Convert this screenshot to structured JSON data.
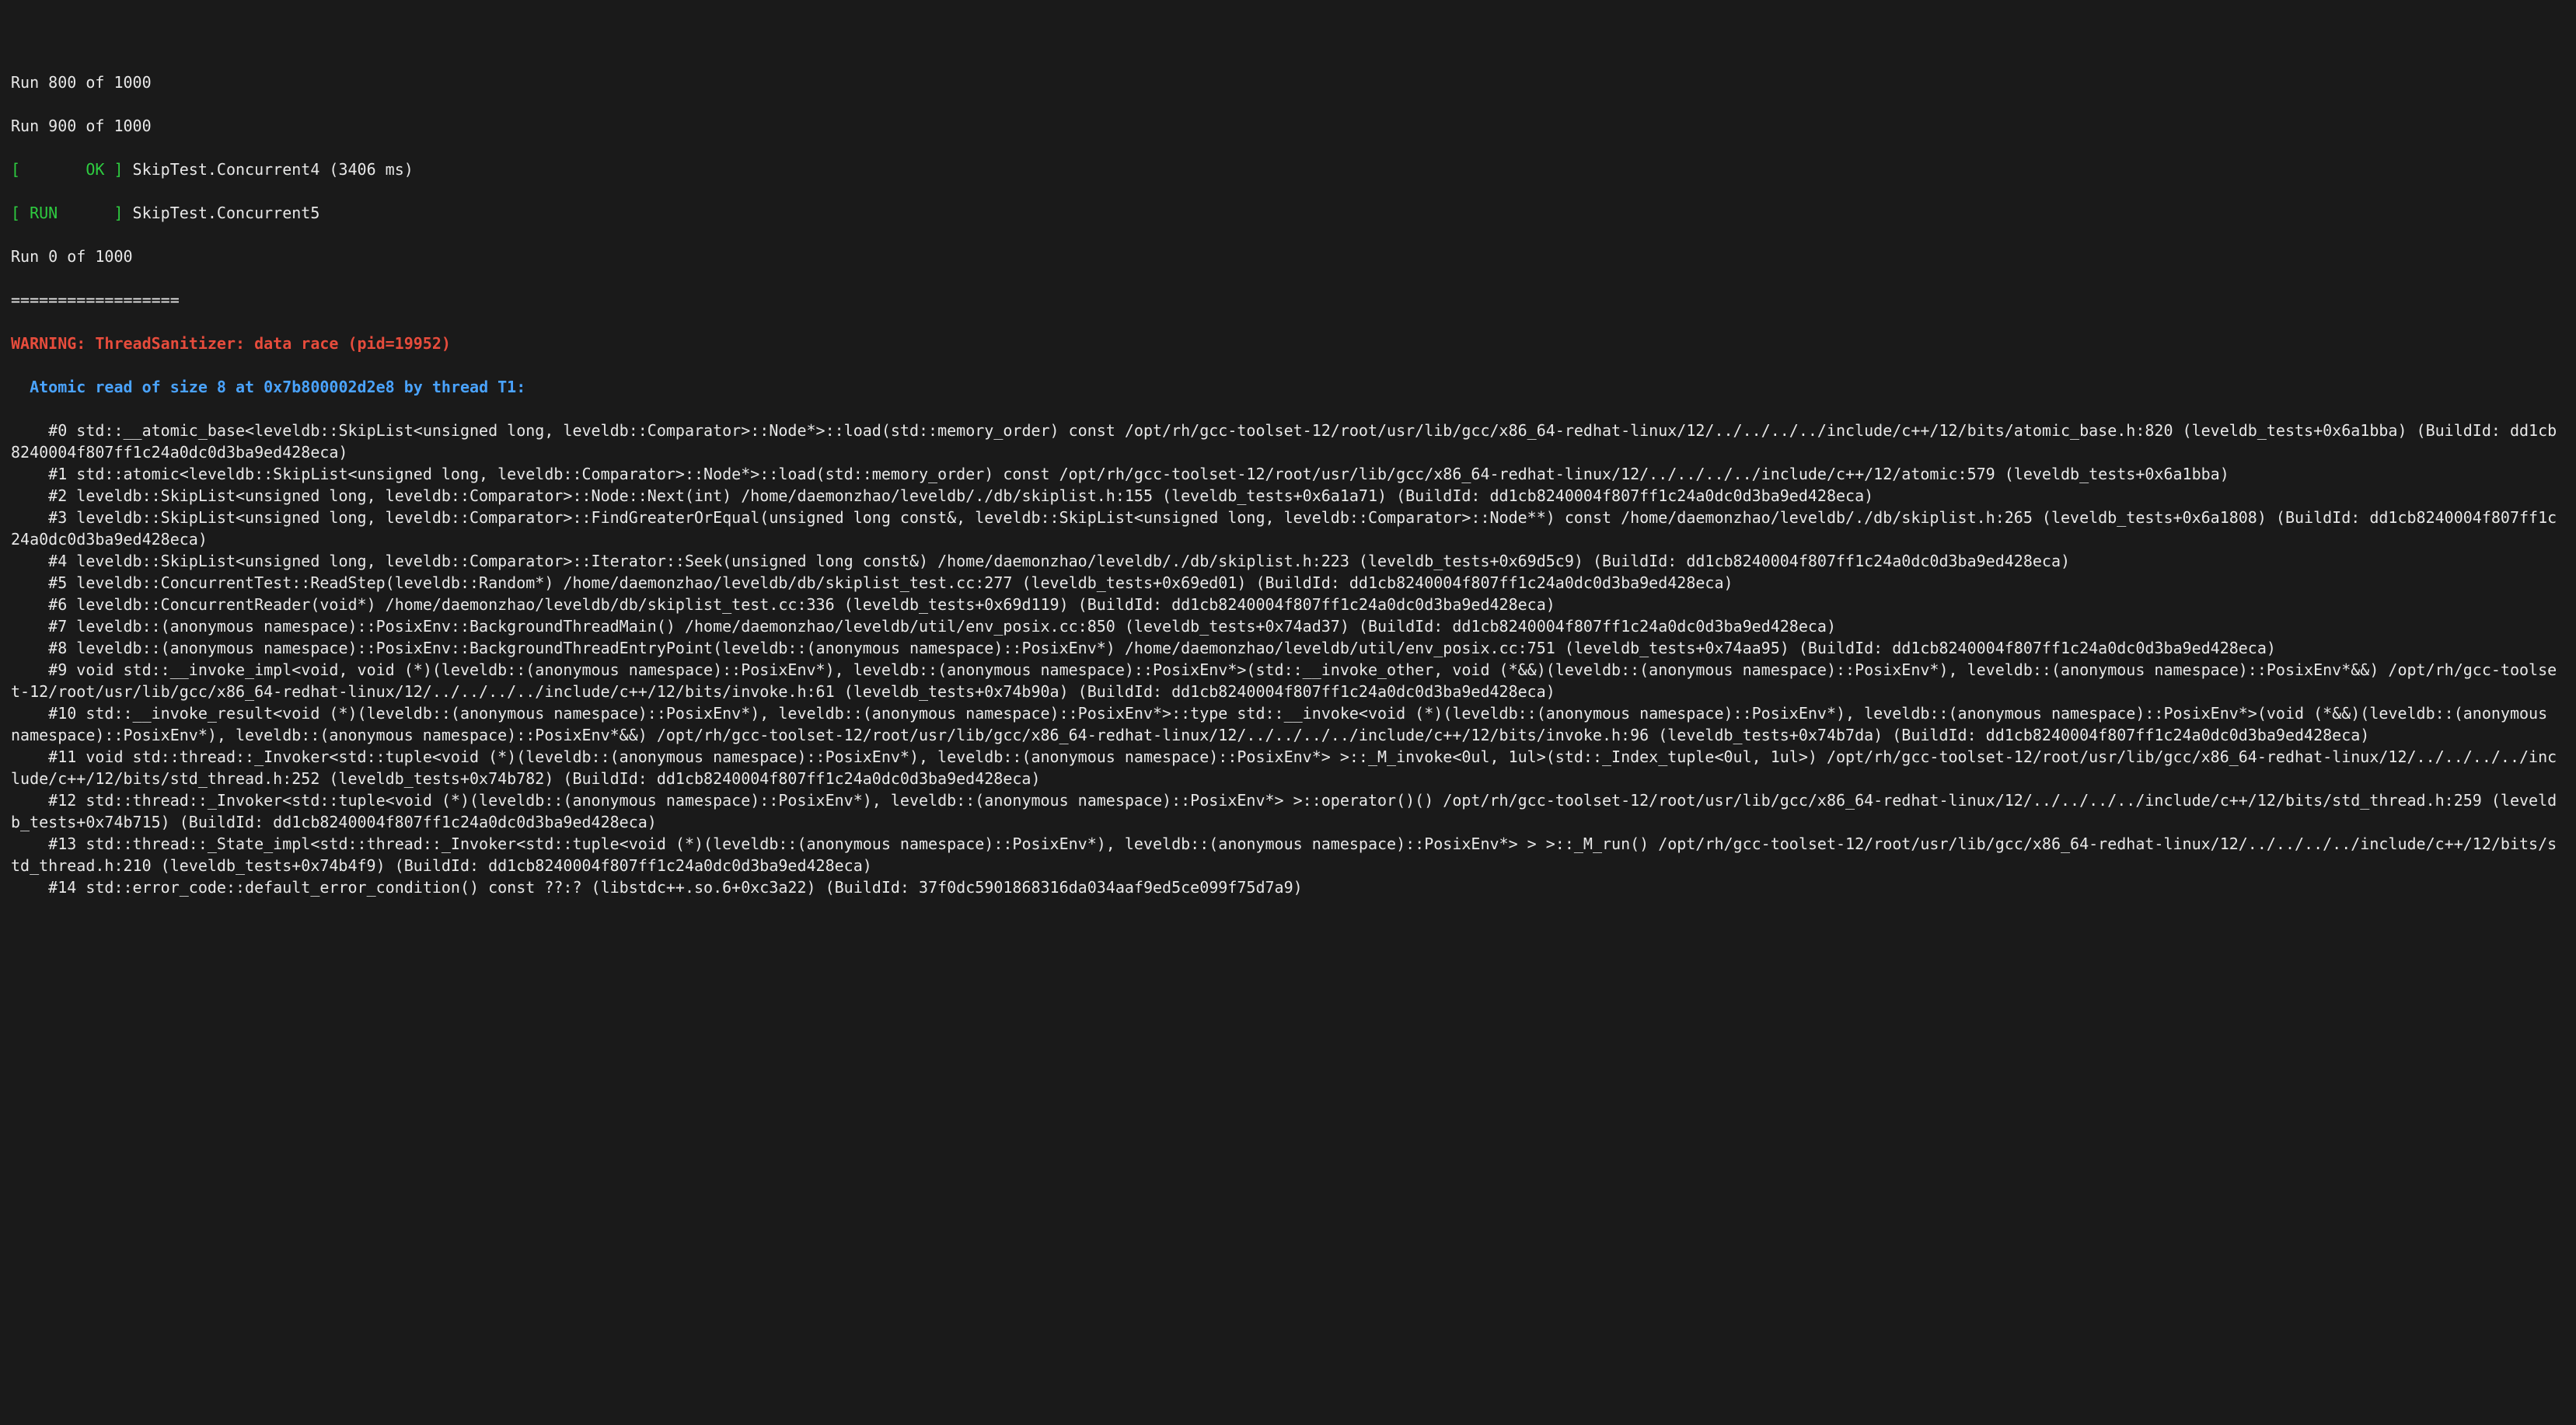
{
  "progress": {
    "run800": "Run 800 of 1000",
    "run900": "Run 900 of 1000",
    "ok_open": "[       OK ]",
    "ok_text": " SkipTest.Concurrent4 (3406 ms)",
    "run_open": "[ RUN      ]",
    "run_text": " SkipTest.Concurrent5",
    "run0": "Run 0 of 1000"
  },
  "divider": "==================",
  "warn": "WARNING: ThreadSanitizer: data race (pid=19952)",
  "read_hdr": "  Atomic read of size 8 at 0x7b800002d2e8 by thread T1:",
  "frames": [
    "    #0 std::__atomic_base<leveldb::SkipList<unsigned long, leveldb::Comparator>::Node*>::load(std::memory_order) const /opt/rh/gcc-toolset-12/root/usr/lib/gcc/x86_64-redhat-linux/12/../../../../include/c++/12/bits/atomic_base.h:820 (leveldb_tests+0x6a1bba) (BuildId: dd1cb8240004f807ff1c24a0dc0d3ba9ed428eca)",
    "    #1 std::atomic<leveldb::SkipList<unsigned long, leveldb::Comparator>::Node*>::load(std::memory_order) const /opt/rh/gcc-toolset-12/root/usr/lib/gcc/x86_64-redhat-linux/12/../../../../include/c++/12/atomic:579 (leveldb_tests+0x6a1bba)",
    "    #2 leveldb::SkipList<unsigned long, leveldb::Comparator>::Node::Next(int) /home/daemonzhao/leveldb/./db/skiplist.h:155 (leveldb_tests+0x6a1a71) (BuildId: dd1cb8240004f807ff1c24a0dc0d3ba9ed428eca)",
    "    #3 leveldb::SkipList<unsigned long, leveldb::Comparator>::FindGreaterOrEqual(unsigned long const&, leveldb::SkipList<unsigned long, leveldb::Comparator>::Node**) const /home/daemonzhao/leveldb/./db/skiplist.h:265 (leveldb_tests+0x6a1808) (BuildId: dd1cb8240004f807ff1c24a0dc0d3ba9ed428eca)",
    "    #4 leveldb::SkipList<unsigned long, leveldb::Comparator>::Iterator::Seek(unsigned long const&) /home/daemonzhao/leveldb/./db/skiplist.h:223 (leveldb_tests+0x69d5c9) (BuildId: dd1cb8240004f807ff1c24a0dc0d3ba9ed428eca)",
    "    #5 leveldb::ConcurrentTest::ReadStep(leveldb::Random*) /home/daemonzhao/leveldb/db/skiplist_test.cc:277 (leveldb_tests+0x69ed01) (BuildId: dd1cb8240004f807ff1c24a0dc0d3ba9ed428eca)",
    "    #6 leveldb::ConcurrentReader(void*) /home/daemonzhao/leveldb/db/skiplist_test.cc:336 (leveldb_tests+0x69d119) (BuildId: dd1cb8240004f807ff1c24a0dc0d3ba9ed428eca)",
    "    #7 leveldb::(anonymous namespace)::PosixEnv::BackgroundThreadMain() /home/daemonzhao/leveldb/util/env_posix.cc:850 (leveldb_tests+0x74ad37) (BuildId: dd1cb8240004f807ff1c24a0dc0d3ba9ed428eca)",
    "    #8 leveldb::(anonymous namespace)::PosixEnv::BackgroundThreadEntryPoint(leveldb::(anonymous namespace)::PosixEnv*) /home/daemonzhao/leveldb/util/env_posix.cc:751 (leveldb_tests+0x74aa95) (BuildId: dd1cb8240004f807ff1c24a0dc0d3ba9ed428eca)",
    "    #9 void std::__invoke_impl<void, void (*)(leveldb::(anonymous namespace)::PosixEnv*), leveldb::(anonymous namespace)::PosixEnv*>(std::__invoke_other, void (*&&)(leveldb::(anonymous namespace)::PosixEnv*), leveldb::(anonymous namespace)::PosixEnv*&&) /opt/rh/gcc-toolset-12/root/usr/lib/gcc/x86_64-redhat-linux/12/../../../../include/c++/12/bits/invoke.h:61 (leveldb_tests+0x74b90a) (BuildId: dd1cb8240004f807ff1c24a0dc0d3ba9ed428eca)",
    "    #10 std::__invoke_result<void (*)(leveldb::(anonymous namespace)::PosixEnv*), leveldb::(anonymous namespace)::PosixEnv*>::type std::__invoke<void (*)(leveldb::(anonymous namespace)::PosixEnv*), leveldb::(anonymous namespace)::PosixEnv*>(void (*&&)(leveldb::(anonymous namespace)::PosixEnv*), leveldb::(anonymous namespace)::PosixEnv*&&) /opt/rh/gcc-toolset-12/root/usr/lib/gcc/x86_64-redhat-linux/12/../../../../include/c++/12/bits/invoke.h:96 (leveldb_tests+0x74b7da) (BuildId: dd1cb8240004f807ff1c24a0dc0d3ba9ed428eca)",
    "    #11 void std::thread::_Invoker<std::tuple<void (*)(leveldb::(anonymous namespace)::PosixEnv*), leveldb::(anonymous namespace)::PosixEnv*> >::_M_invoke<0ul, 1ul>(std::_Index_tuple<0ul, 1ul>) /opt/rh/gcc-toolset-12/root/usr/lib/gcc/x86_64-redhat-linux/12/../../../../include/c++/12/bits/std_thread.h:252 (leveldb_tests+0x74b782) (BuildId: dd1cb8240004f807ff1c24a0dc0d3ba9ed428eca)",
    "    #12 std::thread::_Invoker<std::tuple<void (*)(leveldb::(anonymous namespace)::PosixEnv*), leveldb::(anonymous namespace)::PosixEnv*> >::operator()() /opt/rh/gcc-toolset-12/root/usr/lib/gcc/x86_64-redhat-linux/12/../../../../include/c++/12/bits/std_thread.h:259 (leveldb_tests+0x74b715) (BuildId: dd1cb8240004f807ff1c24a0dc0d3ba9ed428eca)",
    "    #13 std::thread::_State_impl<std::thread::_Invoker<std::tuple<void (*)(leveldb::(anonymous namespace)::PosixEnv*), leveldb::(anonymous namespace)::PosixEnv*> > >::_M_run() /opt/rh/gcc-toolset-12/root/usr/lib/gcc/x86_64-redhat-linux/12/../../../../include/c++/12/bits/std_thread.h:210 (leveldb_tests+0x74b4f9) (BuildId: dd1cb8240004f807ff1c24a0dc0d3ba9ed428eca)",
    "    #14 std::error_code::default_error_condition() const ??:? (libstdc++.so.6+0xc3a22) (BuildId: 37f0dc5901868316da034aaf9ed5ce099f75d7a9)"
  ]
}
